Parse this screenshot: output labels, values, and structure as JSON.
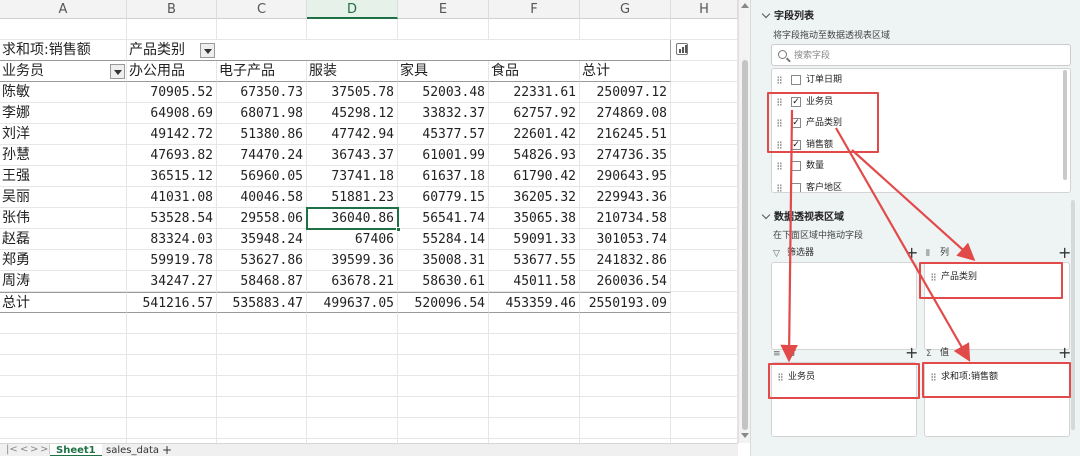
{
  "columns": [
    "A",
    "B",
    "C",
    "D",
    "E",
    "F",
    "G",
    "H"
  ],
  "pivot": {
    "value_label": "求和项:销售额",
    "column_field_label": "产品类别",
    "row_field_label": "业务员",
    "categories": [
      "办公用品",
      "电子产品",
      "服装",
      "家具",
      "食品",
      "总计"
    ],
    "rows": [
      {
        "name": "陈敏",
        "values": [
          "70905.52",
          "67350.73",
          "37505.78",
          "52003.48",
          "22331.61",
          "250097.12"
        ]
      },
      {
        "name": "李娜",
        "values": [
          "64908.69",
          "68071.98",
          "45298.12",
          "33832.37",
          "62757.92",
          "274869.08"
        ]
      },
      {
        "name": "刘洋",
        "values": [
          "49142.72",
          "51380.86",
          "47742.94",
          "45377.57",
          "22601.42",
          "216245.51"
        ]
      },
      {
        "name": "孙慧",
        "values": [
          "47693.82",
          "74470.24",
          "36743.37",
          "61001.99",
          "54826.93",
          "274736.35"
        ]
      },
      {
        "name": "王强",
        "values": [
          "36515.12",
          "56960.05",
          "73741.18",
          "61637.18",
          "61790.42",
          "290643.95"
        ]
      },
      {
        "name": "吴丽",
        "values": [
          "41031.08",
          "40046.58",
          "51881.23",
          "60779.15",
          "36205.32",
          "229943.36"
        ]
      },
      {
        "name": "张伟",
        "values": [
          "53528.54",
          "29558.06",
          "36040.86",
          "56541.74",
          "35065.38",
          "210734.58"
        ]
      },
      {
        "name": "赵磊",
        "values": [
          "83324.03",
          "35948.24",
          "67406",
          "55284.14",
          "59091.33",
          "301053.74"
        ]
      },
      {
        "name": "郑勇",
        "values": [
          "59919.78",
          "53627.86",
          "39599.36",
          "35008.31",
          "53677.55",
          "241832.86"
        ]
      },
      {
        "name": "周涛",
        "values": [
          "34247.27",
          "58468.87",
          "63678.21",
          "58630.61",
          "45011.58",
          "260036.54"
        ]
      }
    ],
    "total": {
      "name": "总计",
      "values": [
        "541216.57",
        "535883.47",
        "499637.05",
        "520096.54",
        "453359.46",
        "2550193.09"
      ]
    }
  },
  "sheet_tabs": {
    "active": "Sheet1",
    "other": "sales_data",
    "add": "+"
  },
  "panel": {
    "field_list_title": "字段列表",
    "field_list_hint": "将字段拖动至数据透视表区域",
    "search_placeholder": "搜索字段",
    "fields": [
      {
        "label": "订单日期",
        "checked": false
      },
      {
        "label": "业务员",
        "checked": true
      },
      {
        "label": "产品类别",
        "checked": true
      },
      {
        "label": "销售额",
        "checked": true
      },
      {
        "label": "数量",
        "checked": false
      },
      {
        "label": "客户地区",
        "checked": false
      }
    ],
    "areas_title": "数据透视表区域",
    "areas_hint": "在下面区域中拖动字段",
    "zones": {
      "filter": {
        "label": "筛选器",
        "item": ""
      },
      "columns": {
        "label": "列",
        "item": "产品类别"
      },
      "rows": {
        "label": "行",
        "item": "业务员"
      },
      "values": {
        "label": "值",
        "item": "求和项:销售额"
      }
    }
  },
  "colors": {
    "annotation_red": "#e24a4a",
    "accent_green": "#1e7145"
  },
  "active_cell": {
    "column": "D",
    "row_name": "张伟",
    "value": "36040.86"
  }
}
